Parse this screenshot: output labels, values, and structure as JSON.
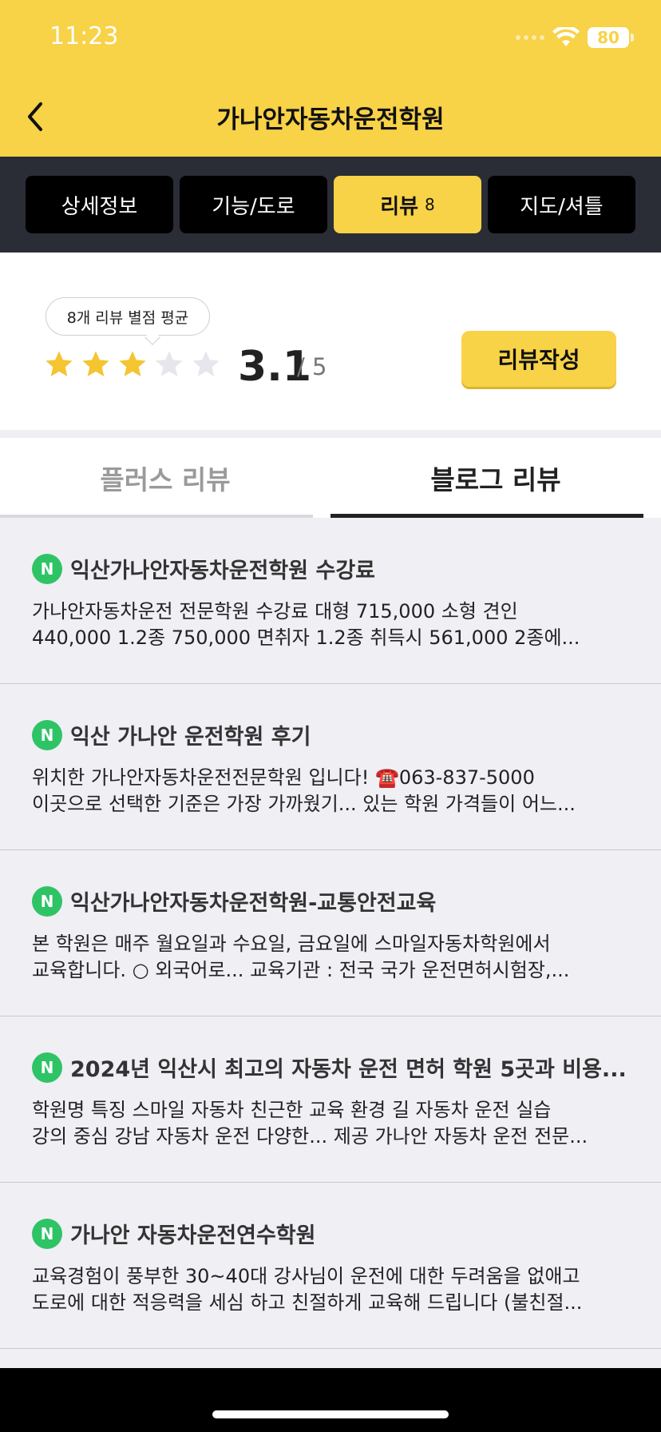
{
  "status_bar": {
    "time": "11:23",
    "battery": "80",
    "wifi_icon": "wifi-icon"
  },
  "header": {
    "title": "가나안자동차운전학원",
    "back_icon": "chevron-left-icon",
    "bg_color": "#f8d247"
  },
  "tabs": [
    {
      "label": "상세정보",
      "count": "",
      "active": false
    },
    {
      "label": "기능/도로",
      "count": "",
      "active": false
    },
    {
      "label": "리뷰",
      "count": "8",
      "active": true
    },
    {
      "label": "지도/셔틀",
      "count": "",
      "active": false
    }
  ],
  "rating": {
    "bubble_text": "8개 리뷰 별점 평균",
    "value": "3.1",
    "max": "/ 5",
    "stars_filled_fraction": 0.62,
    "write_button": "리뷰작성"
  },
  "subtabs": {
    "plus_label": "플러스 리뷰",
    "blog_label": "블로그 리뷰",
    "active": "blog"
  },
  "reviews": [
    {
      "badge": "N",
      "title": "익산가나안자동차운전학원 수강료",
      "line1": "가나안자동차운전 전문학원 수강료 대형 715,000 소형 견인",
      "line2": "440,000 1.2종 750,000 면취자 1.2종 취득시 561,000 2종에..."
    },
    {
      "badge": "N",
      "title": "익산 가나안 운전학원 후기",
      "line1": "위치한 가나안자동차운전전문학원 입니다! ☎️063-837-5000",
      "line2": "이곳으로 선택한 기준은 가장 가까웠기... 있는 학원 가격들이 어느..."
    },
    {
      "badge": "N",
      "title": "익산가나안자동차운전학원-교통안전교육",
      "line1": "본 학원은 매주 월요일과 수요일, 금요일에 스마일자동차학원에서",
      "line2": "교육합니다. ○ 외국어로... 교육기관 : 전국 국가 운전면허시험장,..."
    },
    {
      "badge": "N",
      "title": "2024년 익산시 최고의 자동차 운전 면허 학원 5곳과 비용...",
      "line1": "학원명 특징 스마일 자동차 친근한 교육 환경 길 자동차 운전 실습",
      "line2": "강의 중심 강남 자동차 운전 다양한... 제공 가나안 자동차 운전 전문..."
    },
    {
      "badge": "N",
      "title": "가나안 자동차운전연수학원",
      "line1": "교육경험이 풍부한 30~40대 강사님이 운전에 대한 두려움을 없애고",
      "line2": "도로에 대한 적응력을 세심 하고 친절하게 교육해 드립니다 (불친절..."
    }
  ]
}
